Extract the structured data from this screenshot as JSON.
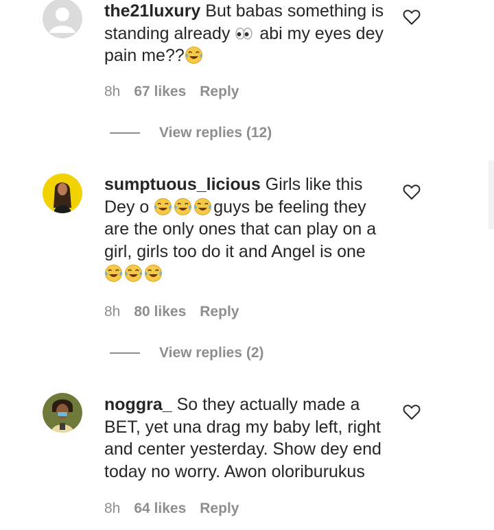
{
  "comments": [
    {
      "username": "the21luxury",
      "avatar": "default-avatar",
      "text_parts": [
        " But babas something is standing already ",
        " abi my eyes dey pain me??"
      ],
      "emojis": [
        "eyes-emoji",
        "laughing-tears-emoji"
      ],
      "time": "8h",
      "likes": "67 likes",
      "reply": "Reply",
      "view_replies": "View replies (12)"
    },
    {
      "username": "sumptuous_licious",
      "avatar": "photo-avatar-woman",
      "text_parts": [
        " Girls like this Dey o ",
        "guys be feeling they are the only ones that can play on a girl, girls too do it and Angel is one "
      ],
      "emojis": [
        "laughing-tears-emoji",
        "laughing-tears-emoji"
      ],
      "time": "8h",
      "likes": "80 likes",
      "reply": "Reply",
      "view_replies": "View replies (2)"
    },
    {
      "username": "noggra_",
      "avatar": "photo-avatar-man",
      "text_parts": [
        " So they actually made a BET, yet una drag my baby left, right and center yesterday. Show dey end today no worry. Awon oloriburukus"
      ],
      "time": "8h",
      "likes": "64 likes",
      "reply": "Reply"
    }
  ],
  "icons": {
    "like": "heart-outline-icon"
  },
  "colors": {
    "text": "#262626",
    "secondary": "#8e8e8e"
  }
}
